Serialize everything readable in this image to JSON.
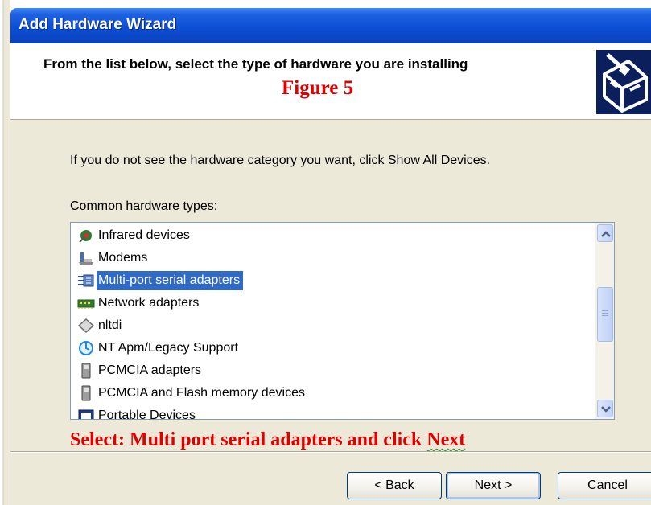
{
  "window": {
    "title": "Add Hardware Wizard",
    "title_bar_color": "#0c4fd4"
  },
  "header": {
    "title": "From the list below, select the type of hardware you are installing",
    "figure_label": "Figure 5",
    "icon": "hardware-wizard-icon"
  },
  "body": {
    "instruction": "If you do not see the hardware category you want, click Show All Devices.",
    "list_label": "Common hardware types:"
  },
  "hardware_list": {
    "selected_index": 2,
    "scroll_position": 0.45,
    "items": [
      {
        "label": "Infrared devices",
        "icon": "infrared-device-icon"
      },
      {
        "label": "Modems",
        "icon": "modem-icon"
      },
      {
        "label": "Multi-port serial adapters",
        "icon": "serial-adapter-icon"
      },
      {
        "label": "Network adapters",
        "icon": "network-adapter-icon"
      },
      {
        "label": "nltdi",
        "icon": "diamond-device-icon"
      },
      {
        "label": "NT Apm/Legacy Support",
        "icon": "apm-support-icon"
      },
      {
        "label": "PCMCIA adapters",
        "icon": "pcmcia-card-icon"
      },
      {
        "label": "PCMCIA and Flash memory devices",
        "icon": "pcmcia-flash-icon"
      },
      {
        "label": "Portable Devices",
        "icon": "portable-device-icon"
      }
    ]
  },
  "callout": {
    "text_before": "Select: Multi port serial adapters and click ",
    "text_emphasis": "Next",
    "color": "#e00000"
  },
  "buttons": {
    "back": "< Back",
    "next": "Next >",
    "cancel": "Cancel"
  },
  "colors": {
    "selection": "#316ac5",
    "dialog_background": "#ece9d8",
    "annotation_red": "#e00000"
  }
}
